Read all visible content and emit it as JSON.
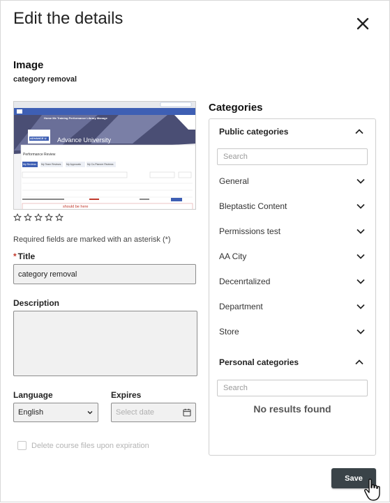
{
  "dialog": {
    "title": "Edit the details"
  },
  "image": {
    "heading": "Image",
    "name": "category removal",
    "rating_stars": 5,
    "rating_value": 0
  },
  "thumb": {
    "nav": [
      "Home",
      "Me",
      "Training",
      "Performance",
      "Library",
      "Manage"
    ],
    "org": "Advance University",
    "logo_text": "ADVANCE U",
    "panel_title": "Performance Review",
    "tabs": [
      "My Reviews",
      "My Team Reviews",
      "My Approvals",
      "My Co-Planner Reviews"
    ],
    "overdue_text": "should be here"
  },
  "form": {
    "required_note": "Required fields are marked with an asterisk (*)",
    "title_label": "Title",
    "title_asterisk": "*",
    "title_value": "category removal",
    "description_label": "Description",
    "description_value": "",
    "language_label": "Language",
    "language_value": "English",
    "expires_label": "Expires",
    "expires_placeholder": "Select date",
    "delete_files_label": "Delete course files upon expiration"
  },
  "categories": {
    "heading": "Categories",
    "public": {
      "heading": "Public categories",
      "search_placeholder": "Search",
      "items": [
        "General",
        "Bleptastic Content",
        "Permissions test",
        "AA City",
        "Decenrtalized",
        "Department",
        "Store"
      ]
    },
    "personal": {
      "heading": "Personal categories",
      "search_placeholder": "Search",
      "empty_text": "No results found"
    }
  },
  "actions": {
    "save_label": "Save"
  },
  "colors": {
    "save_bg": "#3a4348",
    "border": "#cfcfcf",
    "input_bg": "#f1f1f1"
  }
}
